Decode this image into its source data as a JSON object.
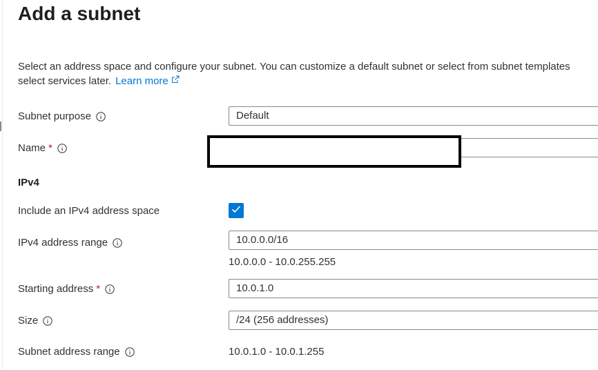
{
  "page": {
    "title": "Add a subnet",
    "description_line1": "Select an address space and configure your subnet. You can customize a default subnet or select from subnet templates",
    "description_line2": "select services later.",
    "learn_more": "Learn more"
  },
  "form": {
    "subnet_purpose": {
      "label": "Subnet purpose",
      "value": "Default"
    },
    "name": {
      "label": "Name",
      "required_mark": "*",
      "value": ""
    },
    "ipv4_section": "IPv4",
    "include_ipv4": {
      "label": "Include an IPv4 address space",
      "checked": true
    },
    "ipv4_range": {
      "label": "IPv4 address range",
      "value": "10.0.0.0/16",
      "hint": "10.0.0.0 - 10.0.255.255"
    },
    "starting_address": {
      "label": "Starting address",
      "required_mark": "*",
      "value": "10.0.1.0"
    },
    "size": {
      "label": "Size",
      "value": "/24 (256 addresses)"
    },
    "subnet_range": {
      "label": "Subnet address range",
      "value": "10.0.1.0 - 10.0.1.255"
    }
  },
  "colors": {
    "accent": "#0078d4",
    "required": "#a4262c",
    "text": "#323130",
    "border": "#8a8886"
  },
  "icons": {
    "info": "info-circle-icon",
    "external": "external-link-icon",
    "check": "checkmark-icon"
  }
}
